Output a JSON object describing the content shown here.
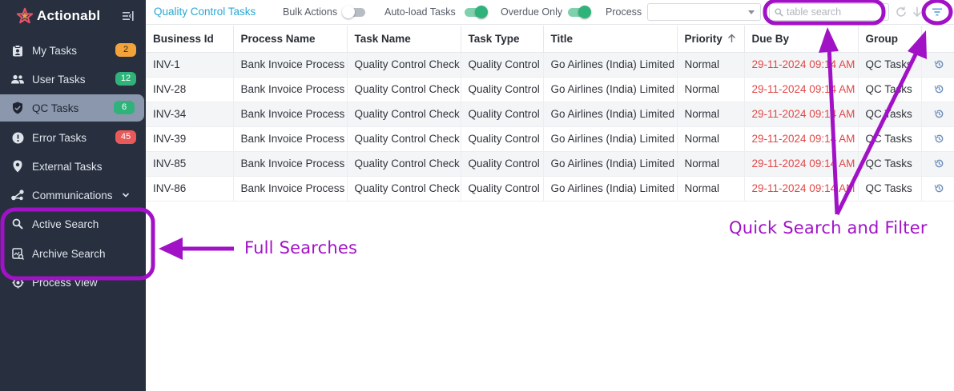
{
  "brand": {
    "name": "Actionabl"
  },
  "sidebar": {
    "items": [
      {
        "label": "My Tasks",
        "icon": "clipboard-user-icon",
        "badge": "2",
        "badge_color": "#f2a33a"
      },
      {
        "label": "User Tasks",
        "icon": "users-icon",
        "badge": "12",
        "badge_color": "#2fb37a"
      },
      {
        "label": "QC Tasks",
        "icon": "shield-check-icon",
        "badge": "6",
        "badge_color": "#2fb37a",
        "active": true
      },
      {
        "label": "Error Tasks",
        "icon": "alert-circle-icon",
        "badge": "45",
        "badge_color": "#e85a5a"
      },
      {
        "label": "External Tasks",
        "icon": "location-pin-icon"
      },
      {
        "label": "Communications",
        "icon": "share-icon",
        "expandable": true
      },
      {
        "label": "Active Search",
        "icon": "search-icon"
      },
      {
        "label": "Archive Search",
        "icon": "archive-search-icon"
      },
      {
        "label": "Process View",
        "icon": "process-view-icon"
      }
    ]
  },
  "toolbar": {
    "title": "Quality Control Tasks",
    "bulk_actions_label": "Bulk Actions",
    "bulk_actions_on": false,
    "auto_load_label": "Auto-load Tasks",
    "auto_load_on": true,
    "overdue_label": "Overdue Only",
    "overdue_on": true,
    "process_label": "Process",
    "process_value": "",
    "search_placeholder": "table search"
  },
  "table": {
    "columns": [
      "Business Id",
      "Process Name",
      "Task Name",
      "Task Type",
      "Title",
      "Priority",
      "Due By",
      "Group",
      ""
    ],
    "sorted_column": "Priority",
    "sort_direction": "ascending",
    "rows": [
      [
        "INV-1",
        "Bank Invoice Process",
        "Quality Control Check",
        "Quality Control",
        "Go Airlines (India) Limited",
        "Normal",
        "29-11-2024 09:14 AM",
        "QC Tasks"
      ],
      [
        "INV-28",
        "Bank Invoice Process",
        "Quality Control Check",
        "Quality Control",
        "Go Airlines (India) Limited",
        "Normal",
        "29-11-2024 09:14 AM",
        "QC Tasks"
      ],
      [
        "INV-34",
        "Bank Invoice Process",
        "Quality Control Check",
        "Quality Control",
        "Go Airlines (India) Limited",
        "Normal",
        "29-11-2024 09:14 AM",
        "QC Tasks"
      ],
      [
        "INV-39",
        "Bank Invoice Process",
        "Quality Control Check",
        "Quality Control",
        "Go Airlines (India) Limited",
        "Normal",
        "29-11-2024 09:14 AM",
        "QC Tasks"
      ],
      [
        "INV-85",
        "Bank Invoice Process",
        "Quality Control Check",
        "Quality Control",
        "Go Airlines (India) Limited",
        "Normal",
        "29-11-2024 09:14 AM",
        "QC Tasks"
      ],
      [
        "INV-86",
        "Bank Invoice Process",
        "Quality Control Check",
        "Quality Control",
        "Go Airlines (India) Limited",
        "Normal",
        "29-11-2024 09:14 AM",
        "QC Tasks"
      ]
    ]
  },
  "annotations": {
    "full_searches": "Full Searches",
    "quick_search_filter": "Quick Search and Filter",
    "color": "#a112c7"
  },
  "colors": {
    "sidebar_bg": "#283040",
    "active_item_bg": "#8b97ad",
    "accent_title": "#2aa7d4",
    "due_date": "#e04848",
    "toggle_on": "#2fb37a"
  }
}
